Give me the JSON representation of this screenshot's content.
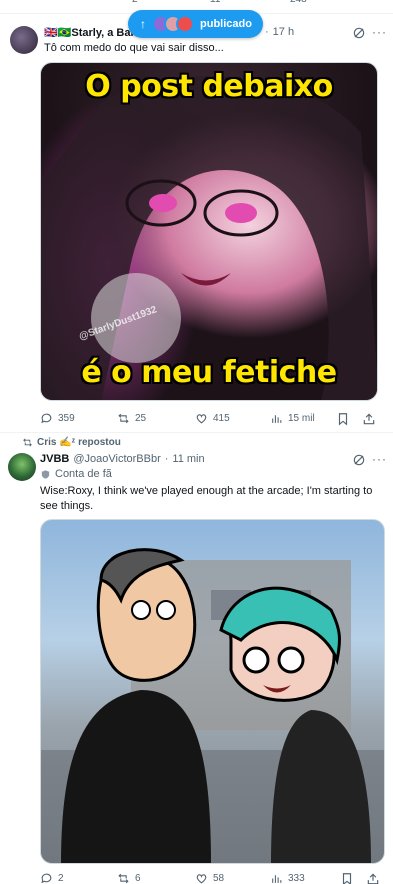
{
  "prev_tweet": {
    "replies": "2",
    "reposts": "11",
    "views": "248"
  },
  "new_posts_pill": {
    "label": "publicado"
  },
  "tweet1": {
    "display_name": "🇬🇧🇧🇷Starly, a Bande",
    "time": "17 h",
    "text": "Tô com medo do que vai sair disso...",
    "media": {
      "caption_top": "O post debaixo",
      "caption_bottom": "é o meu fetiche",
      "watermark": "@StarlyDust1932"
    },
    "stats": {
      "replies": "359",
      "reposts": "25",
      "likes": "415",
      "views": "15 mil"
    }
  },
  "tweet2": {
    "repost_label": "Cris ✍ᶻ repostou",
    "display_name": "JVBB",
    "handle": "@JoaoVictorBBbr",
    "time": "11 min",
    "badge": "Conta de fã",
    "text": "Wise:Roxy, I think we've played enough at the arcade; I'm starting to see things.",
    "stats": {
      "replies": "2",
      "reposts": "6",
      "likes": "58",
      "views": "333"
    }
  },
  "colors": {
    "accent": "#1d9bf0",
    "muted": "#536471",
    "meme_text": "#ffe600"
  }
}
